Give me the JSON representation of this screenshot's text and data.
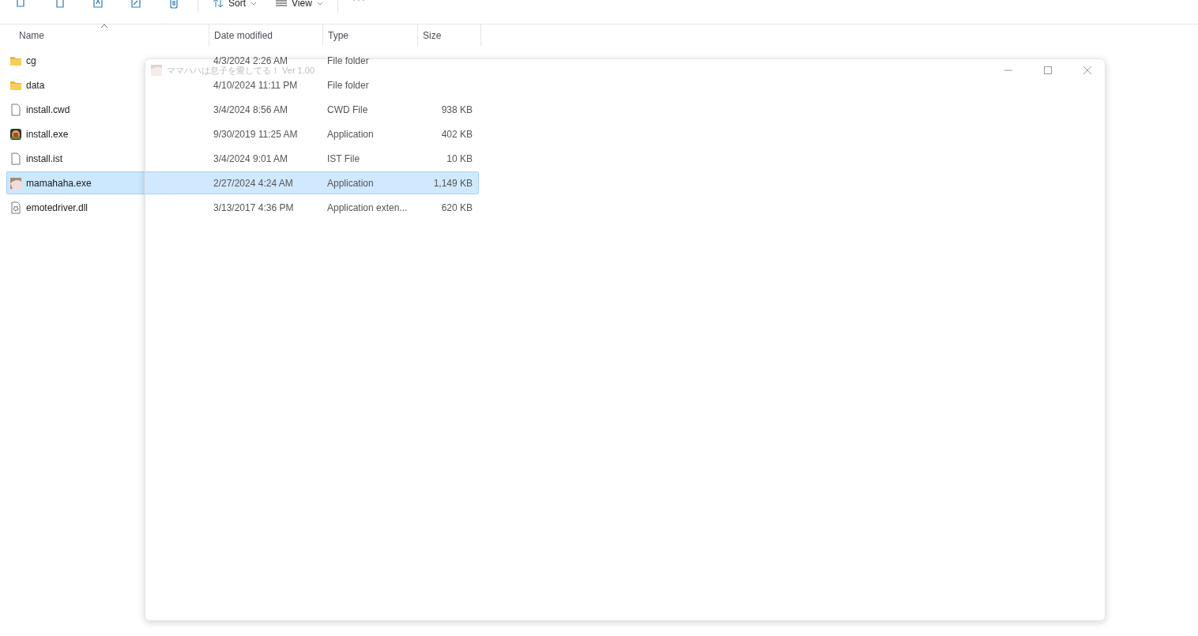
{
  "toolbar": {
    "buttons": [
      {
        "label": "Sort"
      },
      {
        "label": "View"
      }
    ]
  },
  "table": {
    "columns": [
      {
        "label": "Name",
        "sorted": true
      },
      {
        "label": "Date modified",
        "sorted": false
      },
      {
        "label": "Type",
        "sorted": false
      },
      {
        "label": "Size",
        "sorted": false
      }
    ],
    "rows": [
      {
        "name": "cg",
        "kind": "folder",
        "date": "4/3/2024 2:26 AM",
        "type": "File folder",
        "size": "",
        "selected": false
      },
      {
        "name": "data",
        "kind": "folder",
        "date": "4/10/2024 11:11 PM",
        "type": "File folder",
        "size": "",
        "selected": false
      },
      {
        "name": "install.cwd",
        "kind": "file",
        "date": "3/4/2024 8:56 AM",
        "type": "CWD File",
        "size": "938 KB",
        "selected": false
      },
      {
        "name": "install.exe",
        "kind": "emblem",
        "date": "9/30/2019 11:25 AM",
        "type": "Application",
        "size": "402 KB",
        "selected": false
      },
      {
        "name": "install.ist",
        "kind": "file",
        "date": "3/4/2024 9:01 AM",
        "type": "IST File",
        "size": "10 KB",
        "selected": false
      },
      {
        "name": "mamahaha.exe",
        "kind": "avatar",
        "date": "2/27/2024 4:24 AM",
        "type": "Application",
        "size": "1,149 KB",
        "selected": true
      },
      {
        "name": "emotedriver.dll",
        "kind": "library",
        "date": "3/13/2017 4:36 PM",
        "type": "Application exten...",
        "size": "620 KB",
        "selected": false
      }
    ]
  },
  "app_window": {
    "title": "ママハハは息子を愛してる！ Ver 1.00"
  }
}
